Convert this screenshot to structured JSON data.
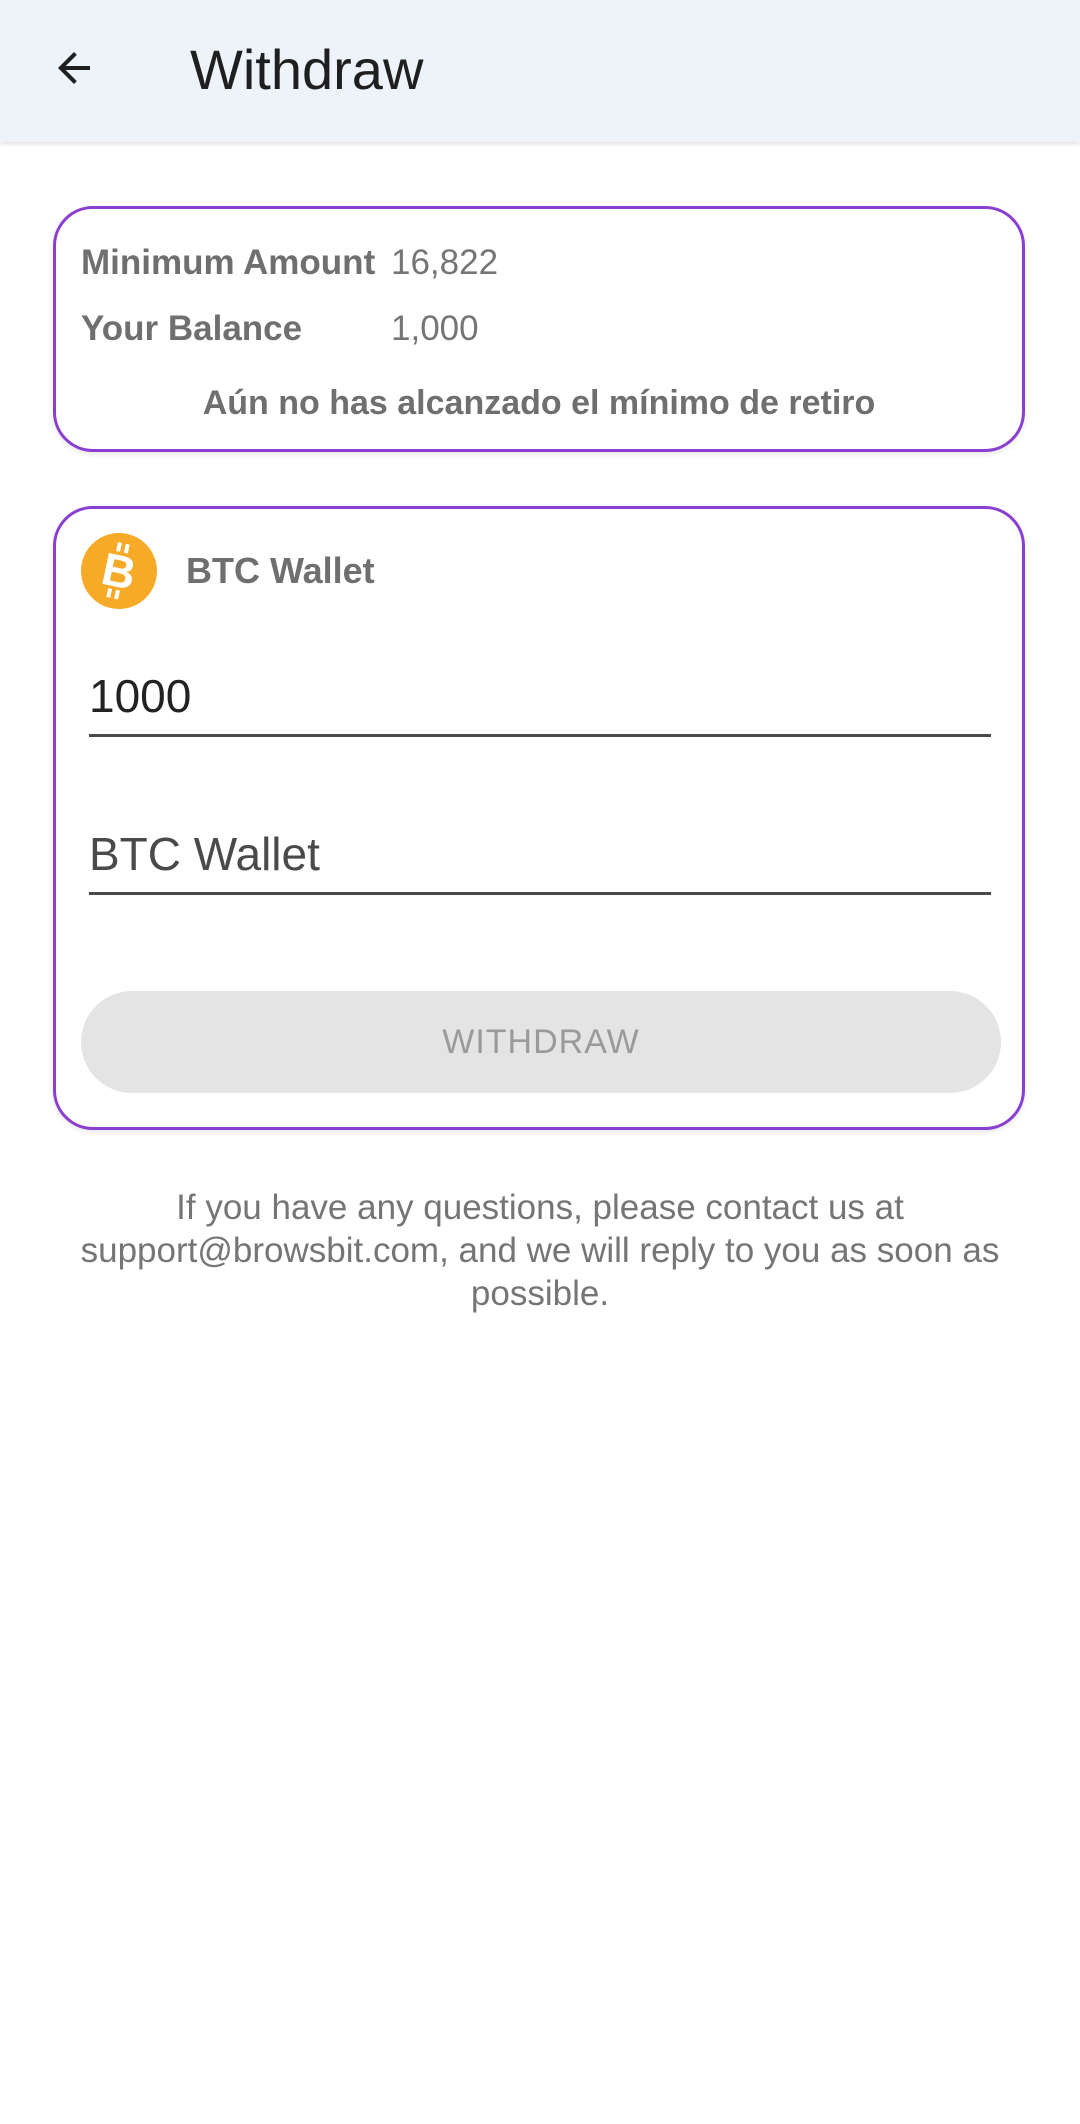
{
  "appbar": {
    "title": "Withdraw",
    "back_icon": "arrow-left-icon"
  },
  "info": {
    "minimum_label": "Minimum Amount",
    "minimum_value": "16,822",
    "balance_label": "Your Balance",
    "balance_value": "1,000",
    "notice": "Aún no has alcanzado el mínimo de retiro"
  },
  "wallet": {
    "icon": "bitcoin-icon",
    "title": "BTC Wallet",
    "amount_value": "1000",
    "address_placeholder": "BTC Wallet",
    "withdraw_label": "WITHDRAW"
  },
  "footer": {
    "contact_text": "If you have any questions, please contact us at support@browsbit.com, and we will reply to you as soon as possible."
  },
  "colors": {
    "accent_border": "#8a3fd1",
    "bitcoin": "#f7a928",
    "appbar_bg": "#eef3fa",
    "button_disabled_bg": "#e4e4e4"
  }
}
